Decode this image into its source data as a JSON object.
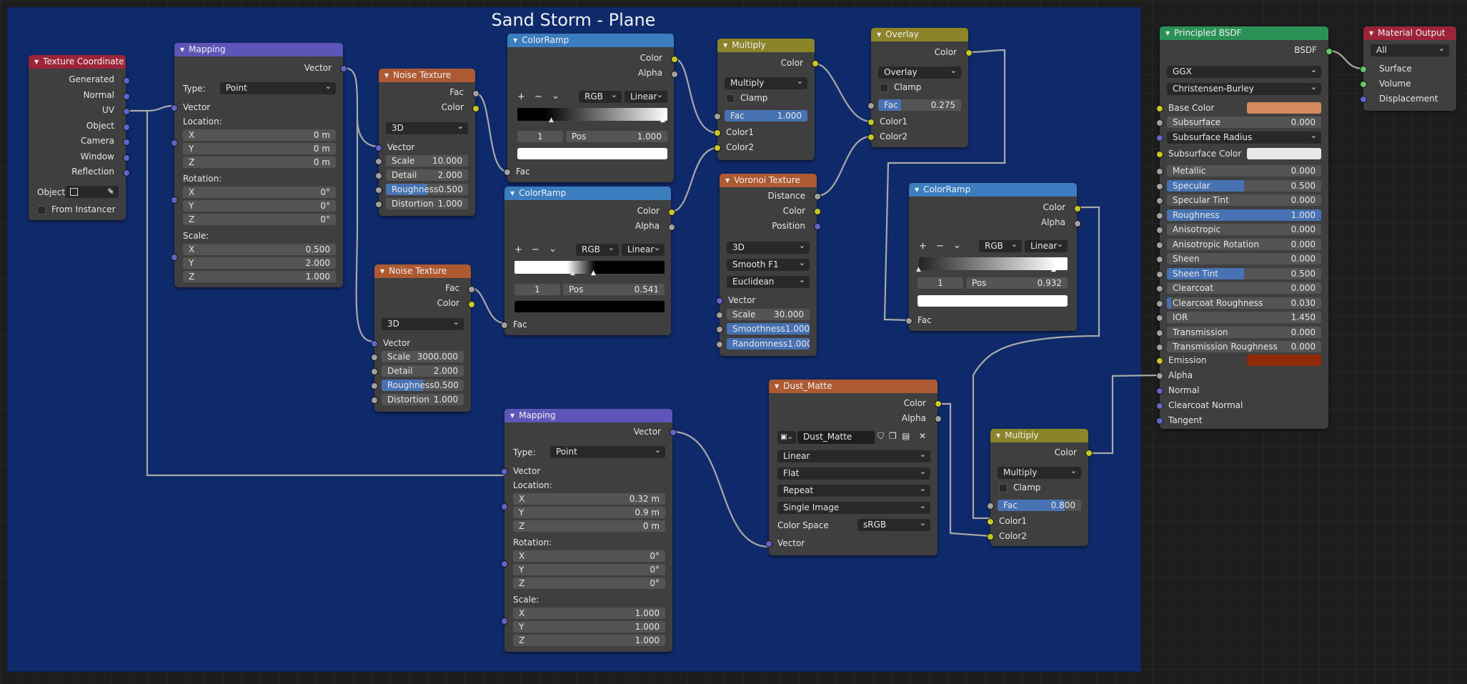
{
  "frame": {
    "title": "Sand Storm - Plane"
  },
  "texcoord": {
    "title": "Texture Coordinate",
    "outputs": [
      "Generated",
      "Normal",
      "UV",
      "Object",
      "Camera",
      "Window",
      "Reflection"
    ],
    "object_label": "Object:",
    "from_instancer": "From Instancer"
  },
  "mapping1": {
    "title": "Mapping",
    "out": "Vector",
    "type_label": "Type:",
    "type_value": "Point",
    "in": "Vector",
    "location": "Location:",
    "rotation": "Rotation:",
    "scale": "Scale:",
    "x": "X",
    "y": "Y",
    "z": "Z",
    "loc": [
      "0 m",
      "0 m",
      "0 m"
    ],
    "rot": [
      "0°",
      "0°",
      "0°"
    ],
    "scl": [
      "0.500",
      "2.000",
      "1.000"
    ]
  },
  "noise1": {
    "title": "Noise Texture",
    "out_fac": "Fac",
    "out_color": "Color",
    "dim": "3D",
    "vector": "Vector",
    "scale_k": "Scale",
    "scale_v": "10.000",
    "detail_k": "Detail",
    "detail_v": "2.000",
    "rough_k": "Roughness",
    "rough_v": "0.500",
    "dist_k": "Distortion",
    "dist_v": "1.000"
  },
  "noise2": {
    "title": "Noise Texture",
    "out_fac": "Fac",
    "out_color": "Color",
    "dim": "3D",
    "vector": "Vector",
    "scale_k": "Scale",
    "scale_v": "3000.000",
    "detail_k": "Detail",
    "detail_v": "2.000",
    "rough_k": "Roughness",
    "rough_v": "0.500",
    "dist_k": "Distortion",
    "dist_v": "1.000"
  },
  "ramp1": {
    "title": "ColorRamp",
    "out_color": "Color",
    "out_alpha": "Alpha",
    "plus": "+",
    "minus": "−",
    "mode": "RGB",
    "interp": "Linear",
    "index": "1",
    "pos_k": "Pos",
    "pos_v": "1.000",
    "in": "Fac",
    "swatch": "#ffffff"
  },
  "ramp2": {
    "title": "ColorRamp",
    "out_color": "Color",
    "out_alpha": "Alpha",
    "plus": "+",
    "minus": "−",
    "mode": "RGB",
    "interp": "Linear",
    "index": "1",
    "pos_k": "Pos",
    "pos_v": "0.541",
    "in": "Fac",
    "swatch": "#000000"
  },
  "ramp3": {
    "title": "ColorRamp",
    "out_color": "Color",
    "out_alpha": "Alpha",
    "plus": "+",
    "minus": "−",
    "mode": "RGB",
    "interp": "Linear",
    "index": "1",
    "pos_k": "Pos",
    "pos_v": "0.932",
    "in": "Fac",
    "swatch": "#ffffff"
  },
  "multiply1": {
    "title": "Multiply",
    "out": "Color",
    "blend": "Multiply",
    "clamp": "Clamp",
    "fac_k": "Fac",
    "fac_v": "1.000",
    "fac_fill": 1.0,
    "c1": "Color1",
    "c2": "Color2"
  },
  "multiply2": {
    "title": "Multiply",
    "out": "Color",
    "blend": "Multiply",
    "clamp": "Clamp",
    "fac_k": "Fac",
    "fac_v": "0.800",
    "fac_fill": 0.8,
    "c1": "Color1",
    "c2": "Color2"
  },
  "overlay": {
    "title": "Overlay",
    "out": "Color",
    "blend": "Overlay",
    "clamp": "Clamp",
    "fac_k": "Fac",
    "fac_v": "0.275",
    "fac_fill": 0.275,
    "c1": "Color1",
    "c2": "Color2"
  },
  "voronoi": {
    "title": "Voronoi Texture",
    "out_dist": "Distance",
    "out_color": "Color",
    "out_pos": "Position",
    "dim": "3D",
    "feature": "Smooth F1",
    "metric": "Euclidean",
    "vector": "Vector",
    "scale_k": "Scale",
    "scale_v": "30.000",
    "smooth_k": "Smoothness",
    "smooth_v": "1.000",
    "rand_k": "Randomness",
    "rand_v": "1.000"
  },
  "dust": {
    "title": "Dust_Matte",
    "out_color": "Color",
    "out_alpha": "Alpha",
    "image": "Dust_Matte",
    "interp": "Linear",
    "proj": "Flat",
    "ext": "Repeat",
    "src": "Single Image",
    "cs_k": "Color Space",
    "cs_v": "sRGB",
    "in": "Vector"
  },
  "mapping2": {
    "title": "Mapping",
    "out": "Vector",
    "type_label": "Type:",
    "type_value": "Point",
    "in": "Vector",
    "location": "Location:",
    "rotation": "Rotation:",
    "scale": "Scale:",
    "x": "X",
    "y": "Y",
    "z": "Z",
    "loc": [
      "0.32 m",
      "0.9 m",
      "0 m"
    ],
    "rot": [
      "0°",
      "0°",
      "0°"
    ],
    "scl": [
      "1.000",
      "1.000",
      "1.000"
    ]
  },
  "bsdf": {
    "title": "Principled BSDF",
    "out": "BSDF",
    "dist": "GGX",
    "sss": "Christensen-Burley",
    "base_color_k": "Base Color",
    "base_color": "#d68a5e",
    "subsurface_k": "Subsurface",
    "subsurface_v": "0.000",
    "radius_k": "Subsurface Radius",
    "sscolor_k": "Subsurface Color",
    "sscolor": "#e8e8e8",
    "rows": [
      {
        "k": "Metallic",
        "v": "0.000",
        "fill": 0
      },
      {
        "k": "Specular",
        "v": "0.500",
        "fill": 0.5
      },
      {
        "k": "Specular Tint",
        "v": "0.000",
        "fill": 0
      },
      {
        "k": "Roughness",
        "v": "1.000",
        "fill": 1
      },
      {
        "k": "Anisotropic",
        "v": "0.000",
        "fill": 0
      },
      {
        "k": "Anisotropic Rotation",
        "v": "0.000",
        "fill": 0
      },
      {
        "k": "Sheen",
        "v": "0.000",
        "fill": 0
      },
      {
        "k": "Sheen Tint",
        "v": "0.500",
        "fill": 0.5
      },
      {
        "k": "Clearcoat",
        "v": "0.000",
        "fill": 0
      },
      {
        "k": "Clearcoat Roughness",
        "v": "0.030",
        "fill": 0.03
      },
      {
        "k": "IOR",
        "v": "1.450",
        "fill": 0
      },
      {
        "k": "Transmission",
        "v": "0.000",
        "fill": 0
      },
      {
        "k": "Transmission Roughness",
        "v": "0.000",
        "fill": 0
      }
    ],
    "emission_k": "Emission",
    "emission": "#8f2a08",
    "alpha_k": "Alpha",
    "normal_k": "Normal",
    "ccnormal_k": "Clearcoat Normal",
    "tangent_k": "Tangent"
  },
  "output": {
    "title": "Material Output",
    "target": "All",
    "surface": "Surface",
    "volume": "Volume",
    "displacement": "Displacement"
  },
  "colors": {
    "frame": "#0f2a6b",
    "wire": "#a8a8a8",
    "accent": "#4772b3"
  }
}
